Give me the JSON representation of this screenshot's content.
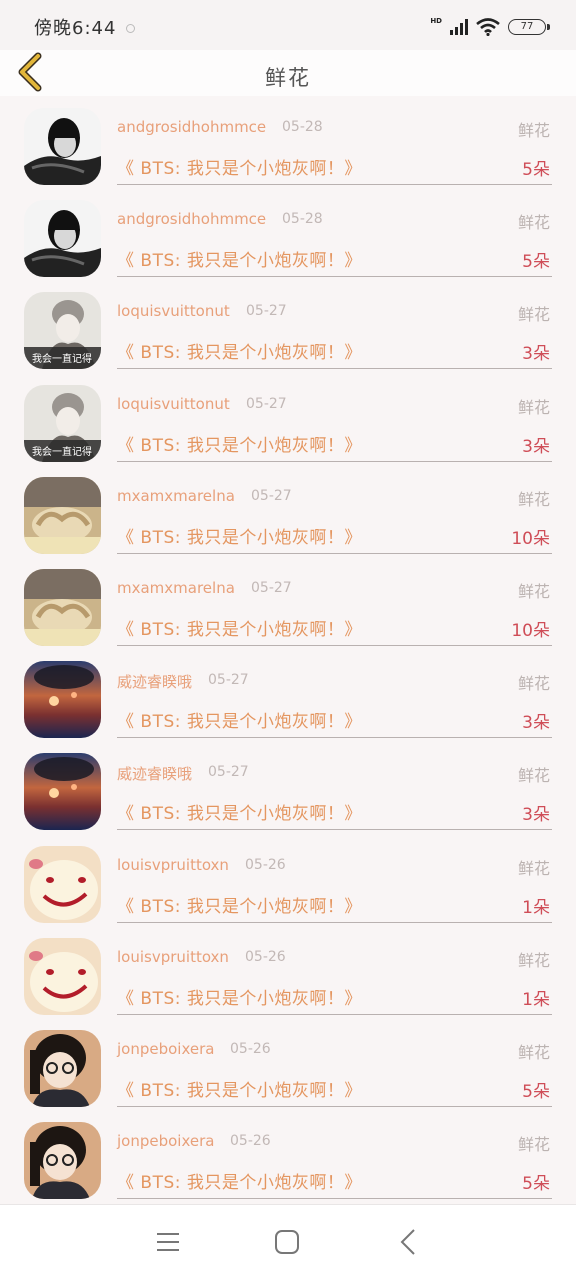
{
  "status_bar": {
    "time": "傍晚6:44",
    "network_label": "HD",
    "battery": "77"
  },
  "header": {
    "title": "鲜花"
  },
  "items": [
    {
      "user": "andgrosidhohmmce",
      "date": "05-28",
      "type": "鲜花",
      "title": "《 BTS: 我只是个小炮灰啊！》",
      "count": "5朵",
      "avatar": "avatar-bw-boy"
    },
    {
      "user": "andgrosidhohmmce",
      "date": "05-28",
      "type": "鲜花",
      "title": "《 BTS: 我只是个小炮灰啊！》",
      "count": "5朵",
      "avatar": "avatar-bw-boy"
    },
    {
      "user": "loquisvuittonut",
      "date": "05-27",
      "type": "鲜花",
      "title": "《 BTS: 我只是个小炮灰啊！》",
      "count": "3朵",
      "avatar": "avatar-girl-hat",
      "avatar_caption": "我会一直记得"
    },
    {
      "user": "loquisvuittonut",
      "date": "05-27",
      "type": "鲜花",
      "title": "《 BTS: 我只是个小炮灰啊！》",
      "count": "3朵",
      "avatar": "avatar-girl-hat",
      "avatar_caption": "我会一直记得"
    },
    {
      "user": "mxamxmarelna",
      "date": "05-27",
      "type": "鲜花",
      "title": "《 BTS: 我只是个小炮灰啊！》",
      "count": "10朵",
      "avatar": "avatar-hands"
    },
    {
      "user": "mxamxmarelna",
      "date": "05-27",
      "type": "鲜花",
      "title": "《 BTS: 我只是个小炮灰啊！》",
      "count": "10朵",
      "avatar": "avatar-hands"
    },
    {
      "user": "威迹睿睽哦",
      "date": "05-27",
      "type": "鲜花",
      "title": "《 BTS: 我只是个小炮灰啊！》",
      "count": "3朵",
      "avatar": "avatar-sunset"
    },
    {
      "user": "威迹睿睽哦",
      "date": "05-27",
      "type": "鲜花",
      "title": "《 BTS: 我只是个小炮灰啊！》",
      "count": "3朵",
      "avatar": "avatar-sunset"
    },
    {
      "user": "louisvpruittoxn",
      "date": "05-26",
      "type": "鲜花",
      "title": "《 BTS: 我只是个小炮灰啊！》",
      "count": "1朵",
      "avatar": "avatar-smiley-cookie"
    },
    {
      "user": "louisvpruittoxn",
      "date": "05-26",
      "type": "鲜花",
      "title": "《 BTS: 我只是个小炮灰啊！》",
      "count": "1朵",
      "avatar": "avatar-smiley-cookie"
    },
    {
      "user": "jonpeboixera",
      "date": "05-26",
      "type": "鲜花",
      "title": "《 BTS: 我只是个小炮灰啊！》",
      "count": "5朵",
      "avatar": "avatar-girl-glasses"
    },
    {
      "user": "jonpeboixera",
      "date": "05-26",
      "type": "鲜花",
      "title": "《 BTS: 我只是个小炮灰啊！》",
      "count": "5朵",
      "avatar": "avatar-girl-glasses"
    }
  ],
  "nav_bar": {
    "buttons": [
      "menu-icon",
      "home-icon",
      "back-icon"
    ]
  },
  "colors": {
    "user_name": "#e8a07a",
    "title": "#e49660",
    "count": "#cf4d57",
    "back_arrow": "#e2b63a"
  }
}
